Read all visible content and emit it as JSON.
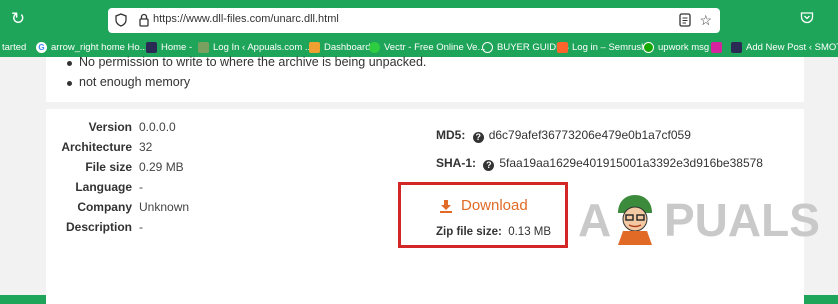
{
  "browser": {
    "url": "https://www.dll-files.com/unarc.dll.html",
    "bookmarks": [
      {
        "label": "tarted",
        "icon": "none"
      },
      {
        "label": "arrow_right  home  Ho...",
        "icon": "google-icon",
        "color": "#ffffff"
      },
      {
        "label": "Home -",
        "icon": "site-icon",
        "color": "#2a2a55"
      },
      {
        "label": "Log In ‹ Appuals.com ...",
        "icon": "site-icon",
        "color": "#7aa060"
      },
      {
        "label": "Dashboard",
        "icon": "folder-icon",
        "color": "#f0a030"
      },
      {
        "label": "Vectr - Free Online Ve...",
        "icon": "circle-icon",
        "color": "#2ecc40"
      },
      {
        "label": "BUYER GUIDES",
        "icon": "globe-icon",
        "color": "#ffffff"
      },
      {
        "label": "Log in – Semrush",
        "icon": "semrush-icon",
        "color": "#ff642d"
      },
      {
        "label": "upwork msg",
        "icon": "upwork-icon",
        "color": "#14a800"
      },
      {
        "label": "",
        "icon": "instagram-icon",
        "color": "#d6249f"
      },
      {
        "label": "Add New Post ‹ SMOT...",
        "icon": "site-icon",
        "color": "#2a2a55"
      }
    ]
  },
  "errors": [
    "No permission to write to where the archive is being unpacked.",
    "not enough memory"
  ],
  "details": [
    {
      "label": "Version",
      "value": "0.0.0.0"
    },
    {
      "label": "Architecture",
      "value": "32"
    },
    {
      "label": "File size",
      "value": "0.29 MB"
    },
    {
      "label": "Language",
      "value": "-"
    },
    {
      "label": "Company",
      "value": "Unknown"
    },
    {
      "label": "Description",
      "value": "-"
    }
  ],
  "hashes": {
    "md5_label": "MD5:",
    "md5": "d6c79afef36773206e479e0b1a7cf059",
    "sha1_label": "SHA-1:",
    "sha1": "5faa19aa1629e401915001a3392e3d916be38578"
  },
  "download": {
    "label": "Download",
    "zip_label": "Zip file size:",
    "zip_size": "0.13 MB"
  },
  "watermark": "APPUALS",
  "colors": {
    "browser_green": "#1fa55a",
    "download_orange": "#e06a26",
    "highlight_red": "#d32626"
  }
}
